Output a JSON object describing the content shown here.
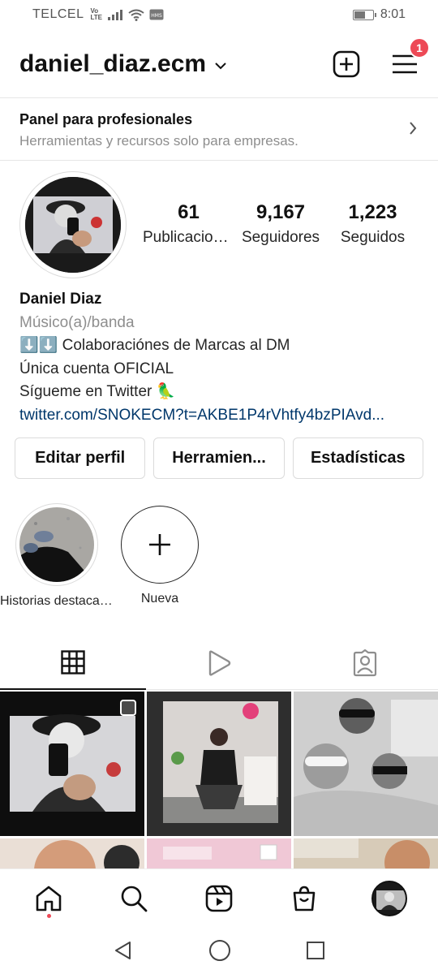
{
  "status_bar": {
    "carrier": "TELCEL",
    "volte": "Vo\nLTE",
    "time": "8:01",
    "battery_level": 0.6
  },
  "header": {
    "username": "daniel_diaz.ecm",
    "notification_count": "1"
  },
  "pro_panel": {
    "title": "Panel para profesionales",
    "subtitle": "Herramientas y recursos solo para empresas."
  },
  "stats": [
    {
      "value": "61",
      "label": "Publicaciones"
    },
    {
      "value": "9,167",
      "label": "Seguidores"
    },
    {
      "value": "1,223",
      "label": "Seguidos"
    }
  ],
  "bio": {
    "name": "Daniel Diaz",
    "category": "Músico(a)/banda",
    "lines": [
      "⬇️⬇️ Colaboraciónes de Marcas al DM",
      "Única cuenta OFICIAL",
      "Sígueme en Twitter 🦜"
    ],
    "link": "twitter.com/SNOKECM?t=AKBE1P4rVhtfy4bzPIAvd..."
  },
  "actions": {
    "edit": "Editar perfil",
    "tools": "Herramien...",
    "stats": "Estadísticas"
  },
  "highlights": [
    {
      "label": "Historias destacadas"
    },
    {
      "label": "Nueva"
    }
  ],
  "tabs": [
    "grid-icon",
    "reels-icon",
    "tagged-icon"
  ],
  "bottom_nav": [
    "home-icon",
    "search-icon",
    "reels-icon",
    "shop-icon",
    "profile-avatar"
  ],
  "colors": {
    "badge": "#ed4956",
    "link": "#00376b",
    "secondary_text": "#8e8e8e"
  }
}
